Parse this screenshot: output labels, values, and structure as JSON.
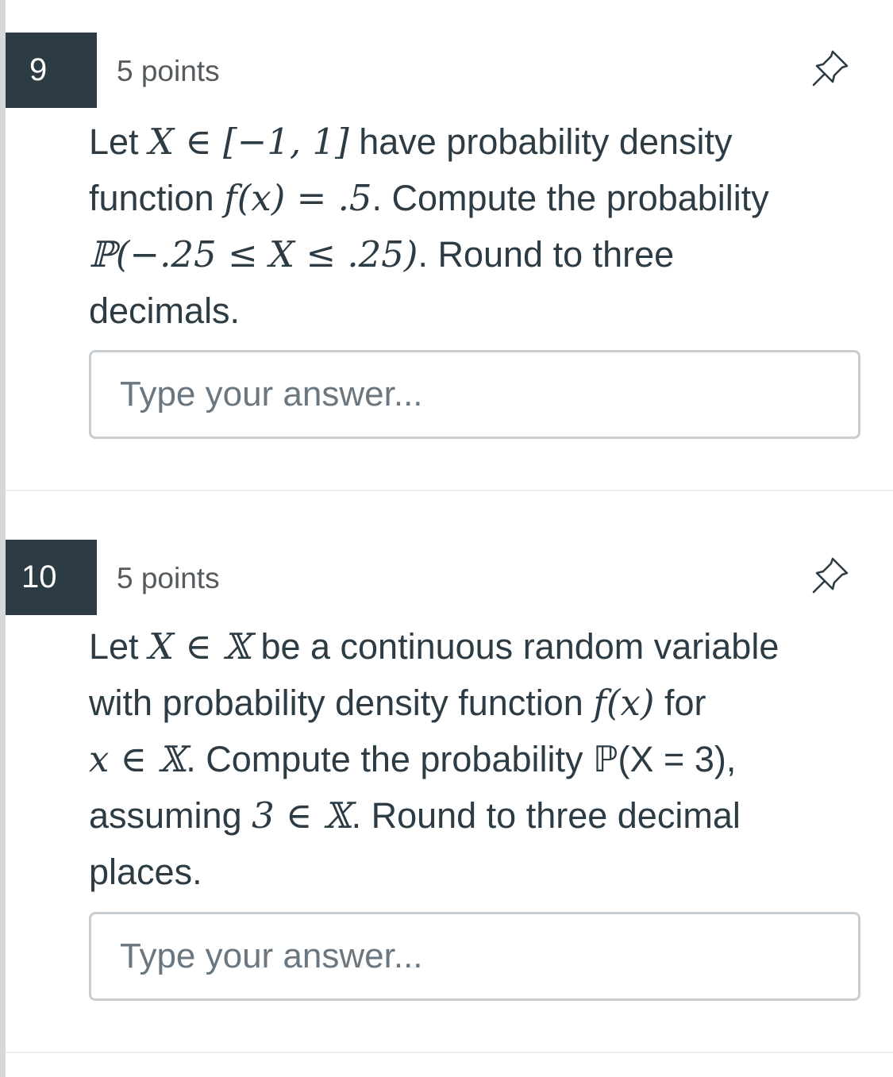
{
  "questions": [
    {
      "number": "9",
      "points": "5 points",
      "pin_icon": "pushpin-icon",
      "text_lines": [
        [
          "Let ",
          "X ∈ [−1, 1]",
          " have probability density"
        ],
        [
          "function ",
          "f(x) = .5",
          ". Compute the probability"
        ],
        [
          "",
          "ℙ(−.25 ≤ X ≤ .25)",
          ". Round to three"
        ],
        [
          "decimals.",
          "",
          ""
        ]
      ],
      "answer_placeholder": "Type your answer...",
      "answer_value": ""
    },
    {
      "number": "10",
      "points": "5 points",
      "pin_icon": "pushpin-icon",
      "text_lines": [
        [
          "Let ",
          "X ∈ 𝕏",
          " be a continuous random variable"
        ],
        [
          "with probability density function ",
          "f(x)",
          " for"
        ],
        [
          "",
          "x ∈ 𝕏",
          ". Compute the probability ℙ(X = 3),"
        ],
        [
          "assuming ",
          "3 ∈ 𝕏",
          ". Round to three decimal"
        ],
        [
          "places.",
          "",
          ""
        ]
      ],
      "answer_placeholder": "Type your answer...",
      "answer_value": ""
    }
  ],
  "colors": {
    "number_badge_bg": "#2d3b45",
    "text": "#2d3b45",
    "border": "#c7cdd1"
  }
}
